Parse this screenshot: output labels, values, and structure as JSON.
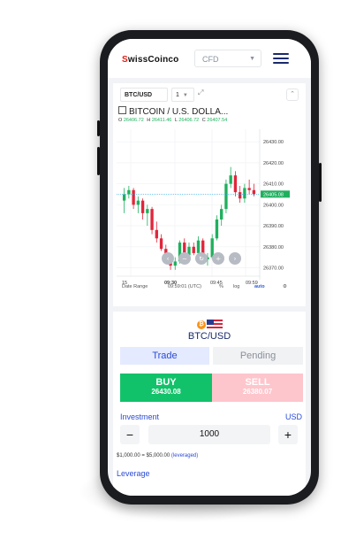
{
  "app": {
    "brand_prefix": "S",
    "brand_rest": "wissCoinco",
    "account_type": "CFD",
    "menu_icon": "hamburger-icon"
  },
  "chart": {
    "symbol": "BTC/USD",
    "interval": "1",
    "title": "BITCOIN / U.S. DOLLA...",
    "ohlc": {
      "o_label": "O",
      "o": "26406.72",
      "h_label": "H",
      "h": "26411.46",
      "l_label": "L",
      "l": "26406.72",
      "c_label": "C",
      "c": "26407.54"
    },
    "bottom": {
      "date_range": "Date Range",
      "time": "09:59:01 (UTC)",
      "percent": "%",
      "log": "log",
      "auto": "auto"
    },
    "colors": {
      "up": "#1fb05e",
      "down": "#e0263c",
      "price_line": "#26a9e0"
    }
  },
  "chart_data": {
    "type": "candlestick",
    "x_tick_labels": [
      "15",
      "09:30",
      "09:45",
      "09:59"
    ],
    "y_tick_labels": [
      "26430.00",
      "26420.00",
      "26410.00",
      "26400.00",
      "26390.00",
      "26380.00",
      "26370.00"
    ],
    "ylim": [
      26366,
      26436
    ],
    "current_price": "26405.08",
    "candles": [
      {
        "o": 26402,
        "h": 26408,
        "l": 26396,
        "c": 26405
      },
      {
        "o": 26405,
        "h": 26409,
        "l": 26403,
        "c": 26407
      },
      {
        "o": 26407,
        "h": 26408,
        "l": 26398,
        "c": 26400
      },
      {
        "o": 26400,
        "h": 26404,
        "l": 26396,
        "c": 26402
      },
      {
        "o": 26402,
        "h": 26403,
        "l": 26393,
        "c": 26396
      },
      {
        "o": 26396,
        "h": 26400,
        "l": 26390,
        "c": 26398
      },
      {
        "o": 26398,
        "h": 26399,
        "l": 26386,
        "c": 26388
      },
      {
        "o": 26388,
        "h": 26392,
        "l": 26382,
        "c": 26384
      },
      {
        "o": 26384,
        "h": 26386,
        "l": 26378,
        "c": 26379
      },
      {
        "o": 26379,
        "h": 26381,
        "l": 26372,
        "c": 26374
      },
      {
        "o": 26374,
        "h": 26376,
        "l": 26369,
        "c": 26371
      },
      {
        "o": 26371,
        "h": 26375,
        "l": 26369,
        "c": 26373
      },
      {
        "o": 26373,
        "h": 26383,
        "l": 26372,
        "c": 26382
      },
      {
        "o": 26382,
        "h": 26384,
        "l": 26374,
        "c": 26376
      },
      {
        "o": 26376,
        "h": 26382,
        "l": 26374,
        "c": 26380
      },
      {
        "o": 26380,
        "h": 26382,
        "l": 26376,
        "c": 26377
      },
      {
        "o": 26377,
        "h": 26385,
        "l": 26375,
        "c": 26383
      },
      {
        "o": 26383,
        "h": 26384,
        "l": 26372,
        "c": 26374
      },
      {
        "o": 26374,
        "h": 26377,
        "l": 26371,
        "c": 26375
      },
      {
        "o": 26375,
        "h": 26386,
        "l": 26374,
        "c": 26384
      },
      {
        "o": 26384,
        "h": 26395,
        "l": 26383,
        "c": 26393
      },
      {
        "o": 26393,
        "h": 26400,
        "l": 26390,
        "c": 26398
      },
      {
        "o": 26398,
        "h": 26412,
        "l": 26396,
        "c": 26410
      },
      {
        "o": 26410,
        "h": 26418,
        "l": 26408,
        "c": 26414
      },
      {
        "o": 26414,
        "h": 26416,
        "l": 26404,
        "c": 26406
      },
      {
        "o": 26406,
        "h": 26409,
        "l": 26401,
        "c": 26403
      },
      {
        "o": 26403,
        "h": 26410,
        "l": 26401,
        "c": 26408
      },
      {
        "o": 26408,
        "h": 26412,
        "l": 26405,
        "c": 26407
      },
      {
        "o": 26407,
        "h": 26410,
        "l": 26404,
        "c": 26405
      }
    ]
  },
  "trade": {
    "pair": "BTC/USD",
    "base_icon": "bitcoin-icon",
    "quote_icon": "us-flag-icon",
    "tab_trade": "Trade",
    "tab_pending": "Pending",
    "buy_label": "BUY",
    "buy_price": "26430.08",
    "sell_label": "SELL",
    "sell_price": "26380.07",
    "investment_label": "Investment",
    "currency": "USD",
    "minus": "−",
    "plus": "+",
    "amount": "1000",
    "leverage_text": "$1,000.00 = $5,000.00",
    "leverage_note": "(leveraged)",
    "leverage_label": "Leverage"
  }
}
